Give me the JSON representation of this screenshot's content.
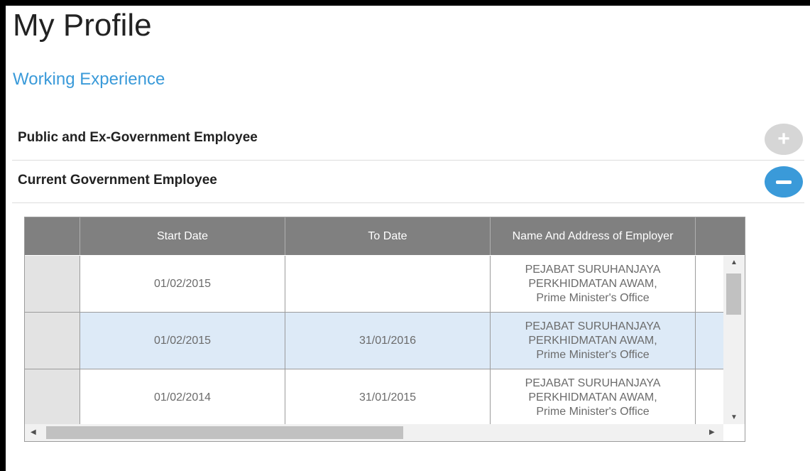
{
  "page": {
    "title": "My Profile",
    "section": "Working Experience"
  },
  "accordion": [
    {
      "label": "Public and Ex-Government Employee",
      "state": "collapsed",
      "icon": "plus-icon"
    },
    {
      "label": "Current Government Employee",
      "state": "expanded",
      "icon": "minus-icon"
    }
  ],
  "table": {
    "headers": [
      "",
      "Start Date",
      "To Date",
      "Name And Address of Employer",
      ""
    ],
    "rows": [
      {
        "start": "01/02/2015",
        "to": "",
        "employer": [
          "PEJABAT SURUHANJAYA",
          "PERKHIDMATAN AWAM,",
          "Prime Minister's Office"
        ],
        "selected": false
      },
      {
        "start": "01/02/2015",
        "to": "31/01/2016",
        "employer": [
          "PEJABAT SURUHANJAYA",
          "PERKHIDMATAN AWAM,",
          "Prime Minister's Office"
        ],
        "selected": true
      },
      {
        "start": "01/02/2014",
        "to": "31/01/2015",
        "employer": [
          "PEJABAT SURUHANJAYA",
          "PERKHIDMATAN AWAM,",
          "Prime Minister's Office"
        ],
        "selected": false
      }
    ]
  },
  "colors": {
    "accent": "#3a9ad9",
    "header_bg": "#808080",
    "selected_row": "#ddeaf7"
  },
  "icons": {
    "scroll_up": "▲",
    "scroll_down": "▼",
    "scroll_left": "◀",
    "scroll_right": "▶"
  }
}
